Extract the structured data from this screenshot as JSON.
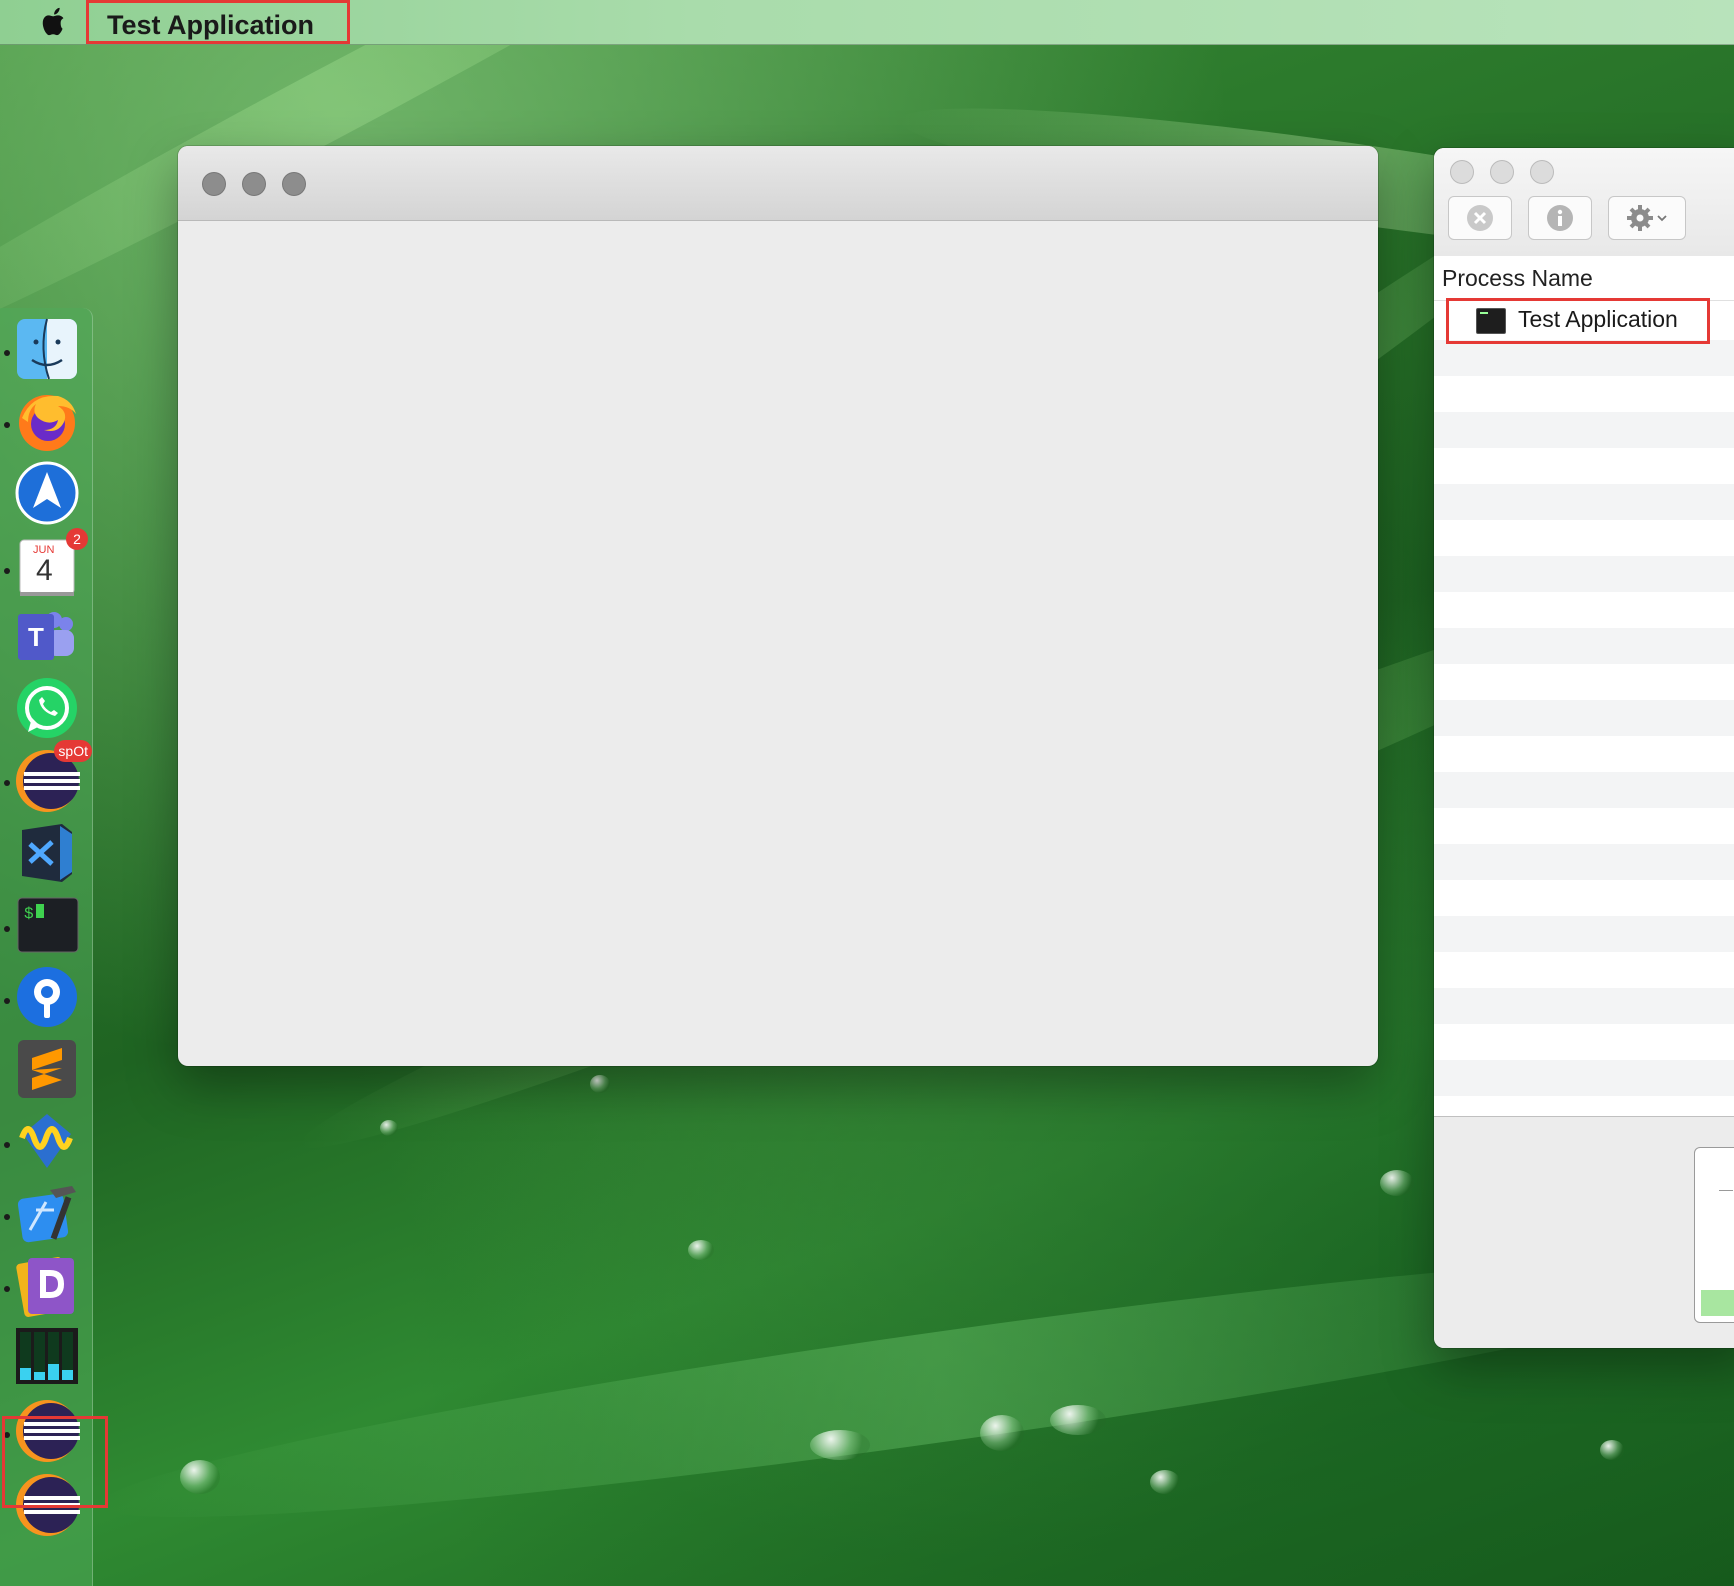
{
  "menubar": {
    "apple_icon": "apple-logo-icon",
    "app_name": "Test Application"
  },
  "dock": {
    "items": [
      {
        "name": "finder-icon",
        "running": true
      },
      {
        "name": "firefox-icon",
        "running": true
      },
      {
        "name": "spark-mail-icon",
        "running": false
      },
      {
        "name": "calendar-icon",
        "running": true,
        "month": "JUN",
        "day": "4",
        "badge": "2"
      },
      {
        "name": "teams-icon",
        "running": false
      },
      {
        "name": "whatsapp-icon",
        "running": false
      },
      {
        "name": "eclipse-spot-icon",
        "running": true,
        "badge": "spOt"
      },
      {
        "name": "vscode-icon",
        "running": false
      },
      {
        "name": "terminal-icon",
        "running": true
      },
      {
        "name": "sourcetree-icon",
        "running": true
      },
      {
        "name": "sublime-text-icon",
        "running": false
      },
      {
        "name": "wireshark-icon",
        "running": true
      },
      {
        "name": "xcode-icon",
        "running": true
      },
      {
        "name": "dash-icon",
        "running": true
      },
      {
        "name": "activity-monitor-icon",
        "running": false
      },
      {
        "name": "eclipse-icon",
        "running": true,
        "highlighted": true
      },
      {
        "name": "eclipse-icon",
        "running": false
      }
    ]
  },
  "activity_monitor": {
    "column_header": "Process Name",
    "selected_process": "Test Application",
    "toolbar": {
      "stop_icon": "stop-process-icon",
      "info_icon": "info-icon",
      "gear_icon": "gear-icon"
    }
  },
  "colors": {
    "highlight": "#e53935",
    "desktop": "#2c7a2c"
  }
}
